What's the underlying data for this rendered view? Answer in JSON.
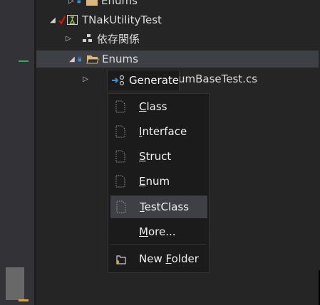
{
  "tree": {
    "enums_top_label": "Enums",
    "project_label": "TNakUtilityTest",
    "dependencies_label": "依存関係",
    "enums_folder_label": "Enums",
    "file_label": "umBaseTest.cs"
  },
  "generate": {
    "label": "Generate"
  },
  "menu": {
    "items": [
      {
        "label": "Class",
        "accel": "C",
        "rest": "lass"
      },
      {
        "label": "Interface",
        "accel": "I",
        "rest": "nterface"
      },
      {
        "label": "Struct",
        "accel": "S",
        "rest": "truct"
      },
      {
        "label": "Enum",
        "accel": "E",
        "rest": "num"
      },
      {
        "label": "TestClass",
        "accel": "T",
        "rest": "estClass"
      },
      {
        "label": "More...",
        "accel": "M",
        "rest": "ore..."
      }
    ],
    "new_folder": {
      "label": "New Folder",
      "pre": "New ",
      "accel": "F",
      "rest": "older"
    }
  },
  "colors": {
    "background": "#252526",
    "menu_background": "#1b1b1c",
    "hover": "#3f3f46",
    "folder": "#dcb67a",
    "check": "#e51400",
    "test_icon": "#8bc34a"
  }
}
